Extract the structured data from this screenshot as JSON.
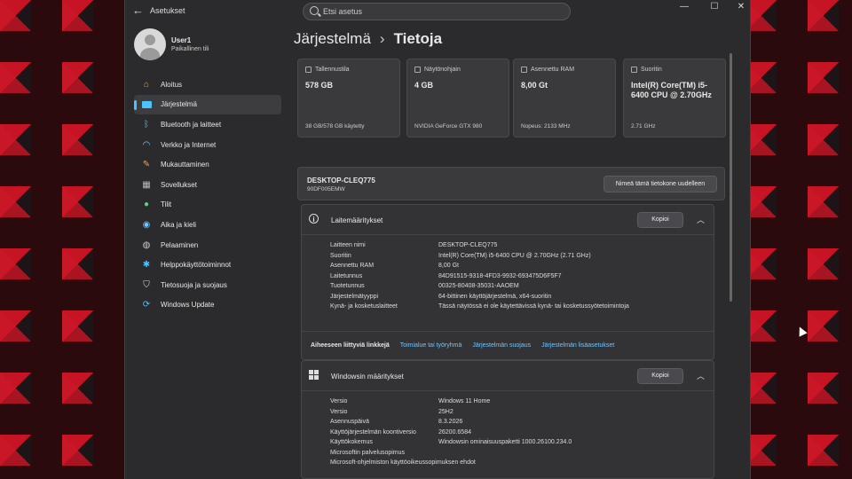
{
  "titlebar": {
    "app_title": "Asetukset",
    "back_icon": "back-arrow-icon",
    "minimize": "—",
    "maximize": "☐",
    "close": "✕"
  },
  "search": {
    "placeholder": "Etsi asetus"
  },
  "profile": {
    "name": "User1",
    "account_type": "Paikallinen tili"
  },
  "nav": {
    "items": [
      {
        "label": "Aloitus",
        "icon": "home-icon"
      },
      {
        "label": "Järjestelmä",
        "icon": "system-icon",
        "active": true
      },
      {
        "label": "Bluetooth ja laitteet",
        "icon": "bluetooth-icon"
      },
      {
        "label": "Verkko ja Internet",
        "icon": "wifi-icon"
      },
      {
        "label": "Mukauttaminen",
        "icon": "brush-icon"
      },
      {
        "label": "Sovellukset",
        "icon": "apps-icon"
      },
      {
        "label": "Tilit",
        "icon": "account-icon"
      },
      {
        "label": "Aika ja kieli",
        "icon": "globe-clock-icon"
      },
      {
        "label": "Pelaaminen",
        "icon": "gamepad-icon"
      },
      {
        "label": "Helppokäyttötoiminnot",
        "icon": "accessibility-icon"
      },
      {
        "label": "Tietosuoja ja suojaus",
        "icon": "shield-icon"
      },
      {
        "label": "Windows Update",
        "icon": "update-icon"
      }
    ]
  },
  "breadcrumb": {
    "parent": "Järjestelmä",
    "separator": "›",
    "current": "Tietoja"
  },
  "cards": [
    {
      "title": "Tallennustila",
      "value": "578 GB",
      "sub": "38 GB/578 GB käytetty",
      "icon": "storage-icon"
    },
    {
      "title": "Näytönohjain",
      "value": "4 GB",
      "sub": "NVIDIA GeForce GTX 980",
      "icon": "gpu-icon"
    },
    {
      "title": "Asennettu RAM",
      "value": "8,00 Gt",
      "sub": "Nopeus: 2133 MHz",
      "icon": "ram-icon"
    },
    {
      "title": "Suoritin",
      "value": "Intel(R) Core(TM) i5-6400 CPU @ 2.70GHz",
      "sub": "2.71 GHz",
      "icon": "cpu-icon"
    }
  ],
  "device": {
    "name": "DESKTOP-CLEQ775",
    "model": "90DF005EMW",
    "rename_button": "Nimeä tämä tietokone uudelleen"
  },
  "device_specs": {
    "title": "Laitemääritykset",
    "copy_button": "Kopioi",
    "rows": [
      {
        "k": "Laitteen nimi",
        "v": "DESKTOP-CLEQ775"
      },
      {
        "k": "Suoritin",
        "v": "Intel(R) Core(TM) i5-6400 CPU @ 2.70GHz (2.71 GHz)"
      },
      {
        "k": "Asennettu RAM",
        "v": "8,00 Gt"
      },
      {
        "k": "Laitetunnus",
        "v": "84D91515-9318-4FD3-9932-693475D6F5F7"
      },
      {
        "k": "Tuotetunnus",
        "v": "00325-80408-35031-AAOEM"
      },
      {
        "k": "Järjestelmätyyppi",
        "v": "64-bittinen käyttöjärjestelmä, x64-suoritin"
      },
      {
        "k": "Kynä- ja kosketuslaitteet",
        "v": "Tässä näytössä ei ole käytettävissä kynä- tai kosketussyötetoimintoja"
      }
    ],
    "related_label": "Aiheeseen liittyviä linkkejä",
    "related_links": [
      "Toimialue tai työryhmä",
      "Järjestelmän suojaus",
      "Järjestelmän lisäasetukset"
    ]
  },
  "windows_specs": {
    "title": "Windowsin määritykset",
    "copy_button": "Kopioi",
    "rows": [
      {
        "k": "Versio",
        "v": "Windows 11 Home"
      },
      {
        "k": "Versio",
        "v": "25H2"
      },
      {
        "k": "Asennuspäivä",
        "v": "8.3.2026"
      },
      {
        "k": "Käyttöjärjestelmän koontiversio",
        "v": "26200.6584"
      },
      {
        "k": "Käyttökokemus",
        "v": "Windowsin ominaisuuspaketti 1000.26100.234.0"
      }
    ],
    "links": [
      "Microsoftin palvelusopimus",
      "Microsoft-ohjelmiston käyttöoikeussopimuksen ehdot"
    ]
  },
  "colors": {
    "accent": "#4cc2ff",
    "link": "#6cc6ff",
    "window_bg": "#2b2b2d",
    "card_bg": "#3a3a3c"
  }
}
